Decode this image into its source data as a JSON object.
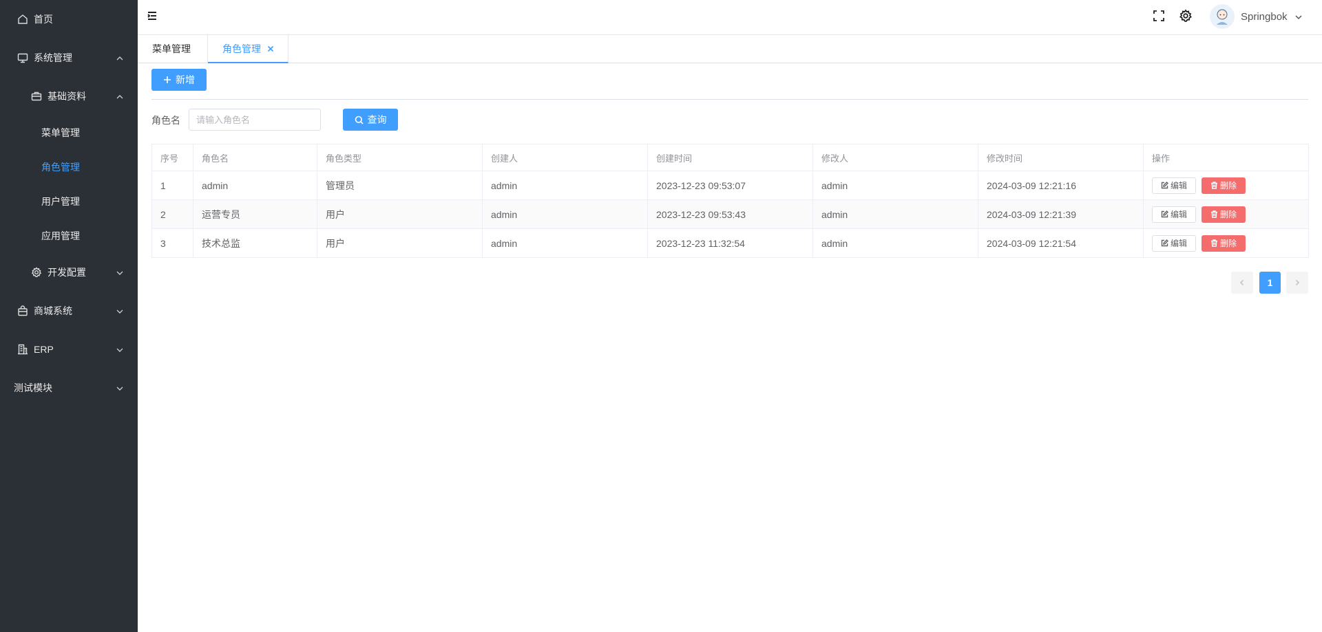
{
  "sidebar": {
    "items": [
      {
        "label": "首页",
        "icon": "home-icon"
      },
      {
        "label": "系统管理",
        "icon": "monitor-icon",
        "expanded": true
      },
      {
        "label": "基础资料",
        "icon": "briefcase-icon",
        "expanded": true
      },
      {
        "label": "菜单管理"
      },
      {
        "label": "角色管理",
        "active": true
      },
      {
        "label": "用户管理"
      },
      {
        "label": "应用管理"
      },
      {
        "label": "开发配置",
        "icon": "gear-icon",
        "expanded": false
      },
      {
        "label": "商城系统",
        "icon": "shopping-bag-icon",
        "expanded": false
      },
      {
        "label": "ERP",
        "icon": "building-icon",
        "expanded": false
      },
      {
        "label": "测试模块",
        "expanded": false
      }
    ]
  },
  "header": {
    "username": "Springbok"
  },
  "tabs": [
    {
      "label": "菜单管理"
    },
    {
      "label": "角色管理",
      "active": true
    }
  ],
  "toolbar": {
    "add_label": "新增"
  },
  "search": {
    "label": "角色名",
    "placeholder": "请输入角色名",
    "query_label": "查询"
  },
  "table": {
    "headers": [
      "序号",
      "角色名",
      "角色类型",
      "创建人",
      "创建时间",
      "修改人",
      "修改时间",
      "操作"
    ],
    "rows": [
      [
        "1",
        "admin",
        "管理员",
        "admin",
        "2023-12-23 09:53:07",
        "admin",
        "2024-03-09 12:21:16"
      ],
      [
        "2",
        "运营专员",
        "用户",
        "admin",
        "2023-12-23 09:53:43",
        "admin",
        "2024-03-09 12:21:39"
      ],
      [
        "3",
        "技术总监",
        "用户",
        "admin",
        "2023-12-23 11:32:54",
        "admin",
        "2024-03-09 12:21:54"
      ]
    ],
    "edit_label": "编辑",
    "delete_label": "删除"
  },
  "pagination": {
    "current": "1"
  },
  "colors": {
    "sidebar_bg": "#2b2f36",
    "accent": "#409eff",
    "danger": "#f56c6c"
  }
}
